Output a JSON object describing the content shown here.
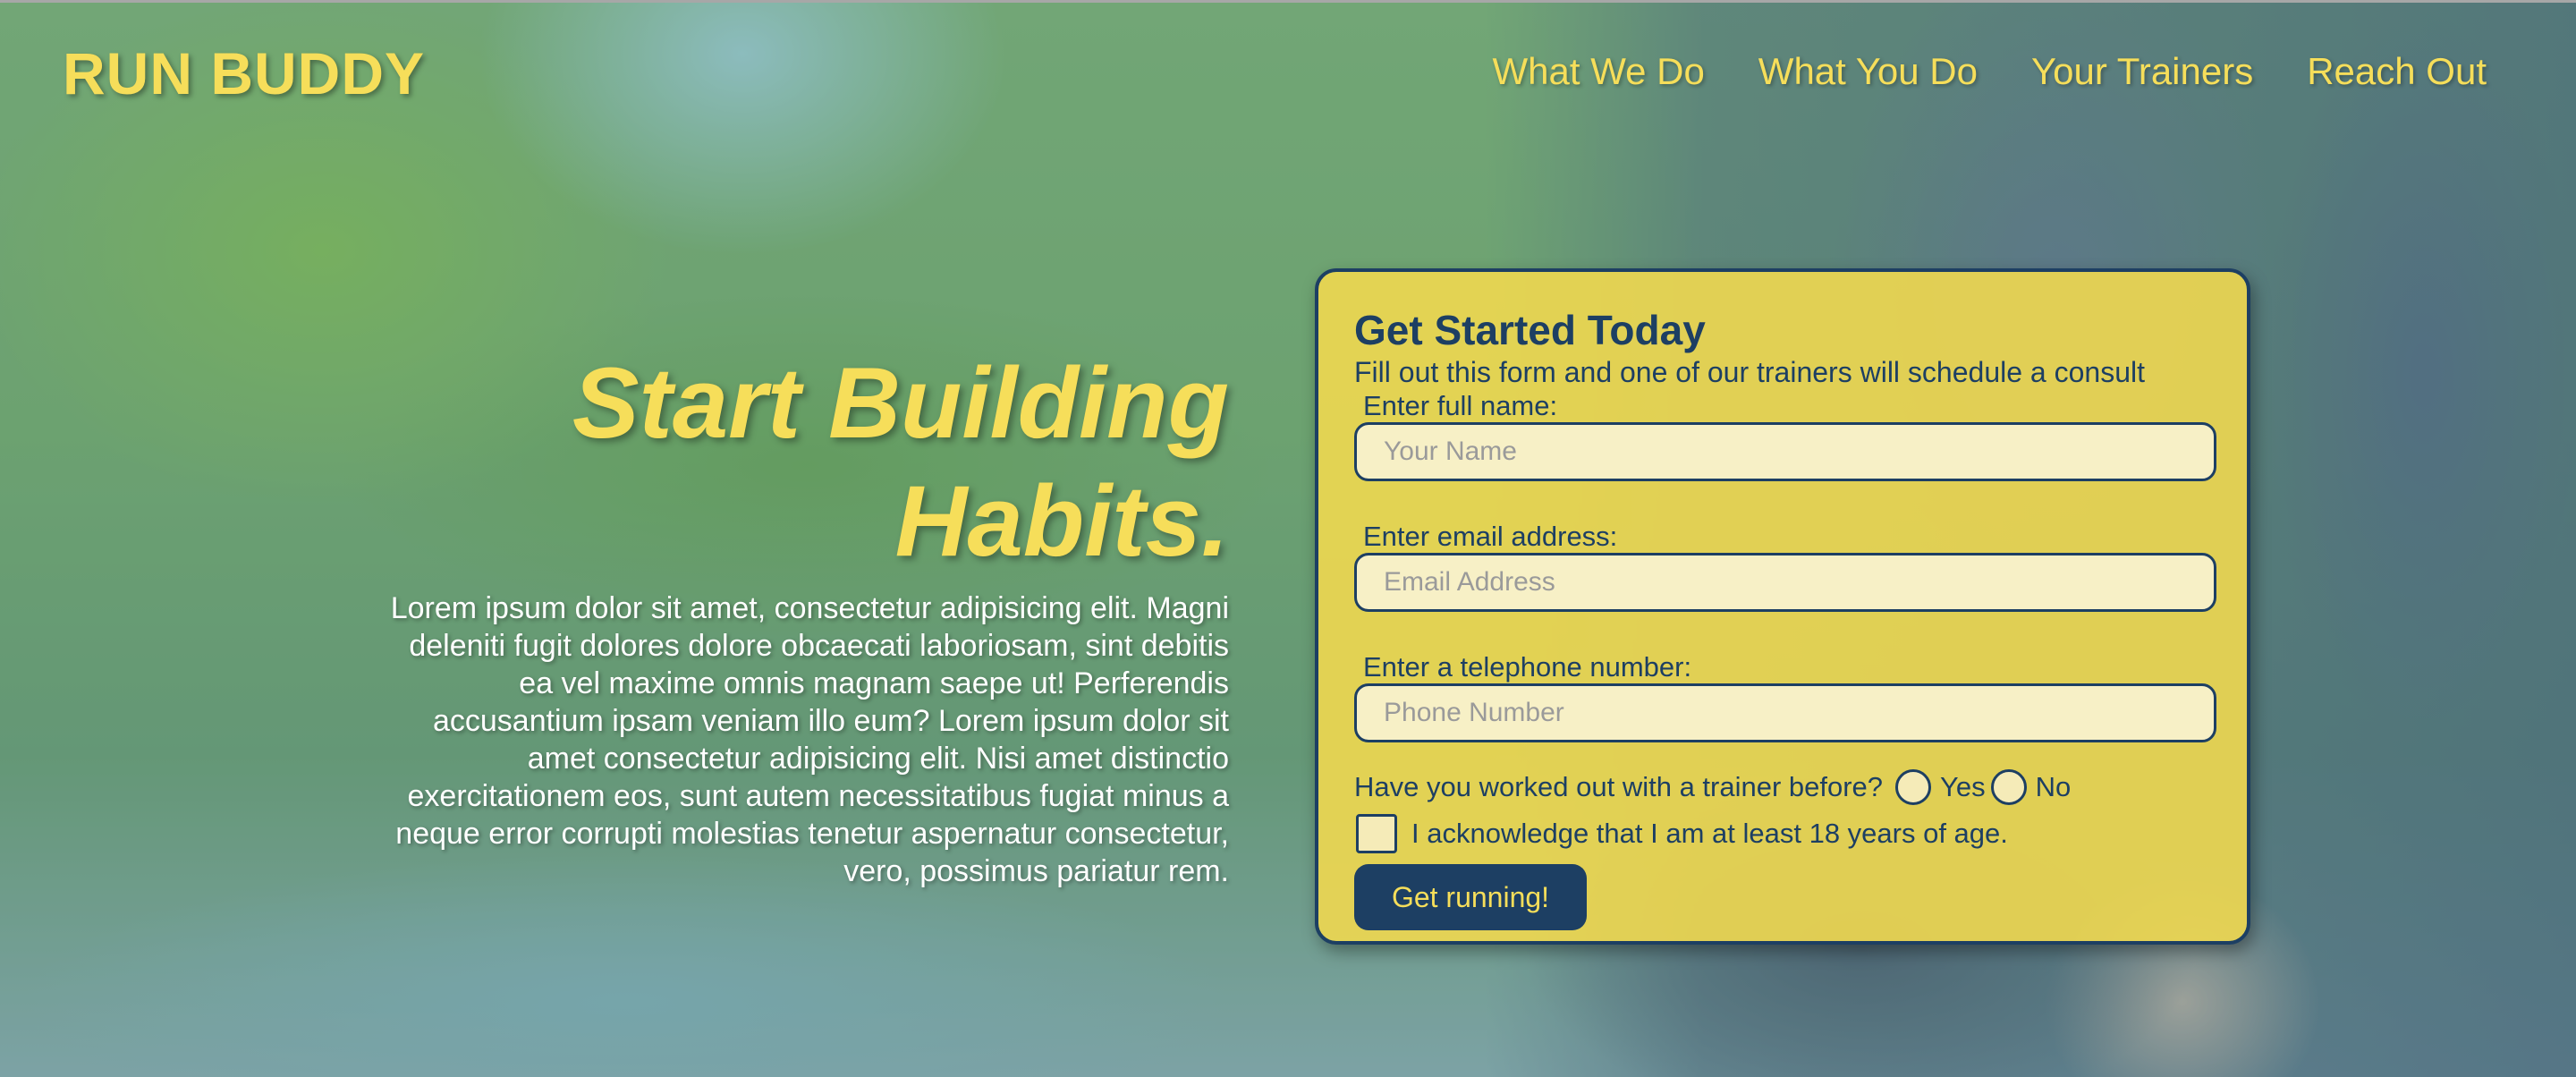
{
  "header": {
    "logo": "RUN BUDDY",
    "nav": [
      "What We Do",
      "What You Do",
      "Your Trainers",
      "Reach Out"
    ]
  },
  "hero": {
    "title_line1": "Start Building",
    "title_line2": "Habits.",
    "body": "Lorem ipsum dolor sit amet, consectetur adipisicing elit. Magni deleniti fugit dolores dolore obcaecati laboriosam, sint debitis ea vel maxime omnis magnam saepe ut! Perferendis accusantium ipsam veniam illo eum? Lorem ipsum dolor sit amet consectetur adipisicing elit. Nisi amet distinctio exercitationem eos, sunt autem necessitatibus fugiat minus a neque error corrupti molestias tenetur aspernatur consectetur, vero, possimus pariatur rem."
  },
  "form": {
    "title": "Get Started Today",
    "subtitle": "Fill out this form and one of our trainers will schedule a consult",
    "name_label": "Enter full name:",
    "name_placeholder": "Your Name",
    "name_value": "",
    "email_label": "Enter email address:",
    "email_placeholder": "Email Address",
    "email_value": "",
    "phone_label": "Enter a telephone number:",
    "phone_placeholder": "Phone Number",
    "phone_value": "",
    "trainer_question": "Have you worked out with a trainer before?",
    "option_yes": "Yes",
    "option_no": "No",
    "age_ack": "I acknowledge that I am at least 18 years of age.",
    "submit_label": "Get running!"
  },
  "colors": {
    "accent_yellow": "#f6de5a",
    "navy": "#1d3f63",
    "card_bg": "#f0d850"
  }
}
